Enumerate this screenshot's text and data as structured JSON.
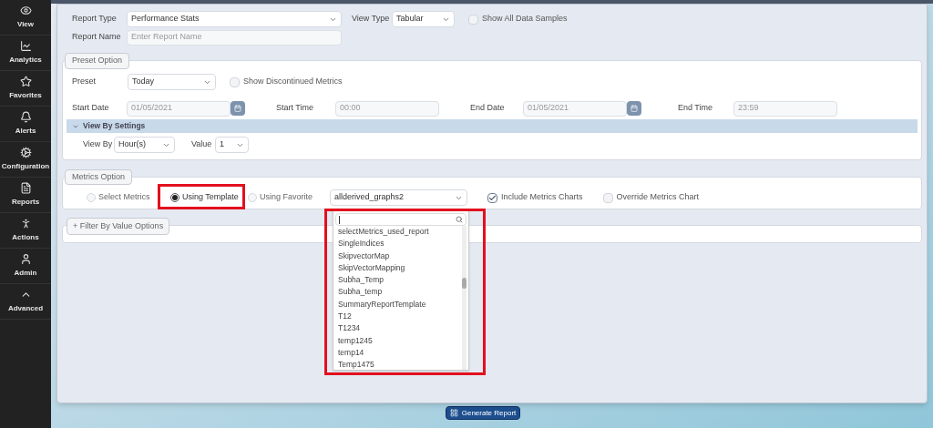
{
  "sidebar": {
    "items": [
      {
        "label": "View",
        "selected": false
      },
      {
        "label": "Analytics",
        "selected": false
      },
      {
        "label": "Favorites",
        "selected": false
      },
      {
        "label": "Alerts",
        "selected": false
      },
      {
        "label": "Configuration",
        "selected": false
      },
      {
        "label": "Reports",
        "selected": false
      },
      {
        "label": "Actions",
        "selected": false
      },
      {
        "label": "Admin",
        "selected": false
      },
      {
        "label": "Advanced",
        "selected": false
      }
    ]
  },
  "report": {
    "report_type": {
      "label": "Report Type",
      "value": "Performance Stats"
    },
    "view_type": {
      "label": "View Type",
      "value": "Tabular"
    },
    "show_all_samples": {
      "label": "Show All Data Samples",
      "checked": false
    },
    "report_name": {
      "label": "Report Name",
      "placeholder": "Enter Report Name"
    }
  },
  "preset_option": {
    "legend": "Preset Option",
    "preset": {
      "label": "Preset",
      "value": "Today"
    },
    "show_discontinued": {
      "label": "Show Discontinued Metrics",
      "checked": false
    },
    "start_date": {
      "label": "Start Date",
      "value": "01/05/2021",
      "disabled": true
    },
    "start_time": {
      "label": "Start Time",
      "value": "00:00",
      "disabled": true
    },
    "end_date": {
      "label": "End Date",
      "value": "01/05/2021",
      "disabled": true
    },
    "end_time": {
      "label": "End Time",
      "value": "23:59",
      "disabled": true
    },
    "view_by_settings": {
      "title": "View By Settings",
      "expanded": true,
      "view_by": {
        "label": "View By",
        "value": "Hour(s)"
      },
      "value": {
        "label": "Value",
        "value": "1"
      }
    }
  },
  "metrics_option": {
    "legend": "Metrics Option",
    "radios": [
      {
        "label": "Select Metrics",
        "selected": false
      },
      {
        "label": "Using Template",
        "selected": true
      },
      {
        "label": "Using Favorite",
        "selected": false
      }
    ],
    "template": {
      "value": "allderived_graphs2",
      "options": [
        "selectMetrics_used_report",
        "SingleIndices",
        "SkipvectorMap",
        "SkipVectorMapping",
        "Subha_Temp",
        "Subha_temp",
        "SummaryReportTemplate",
        "T12",
        "T1234",
        "temp1245",
        "temp14",
        "Temp1475"
      ]
    },
    "include_charts": {
      "label": "Include Metrics Charts",
      "checked": true
    },
    "override_chart": {
      "label": "Override Metrics Chart",
      "checked": false
    }
  },
  "filter_button": "+ Filter By Value Options",
  "generate_button": "Generate Report"
}
